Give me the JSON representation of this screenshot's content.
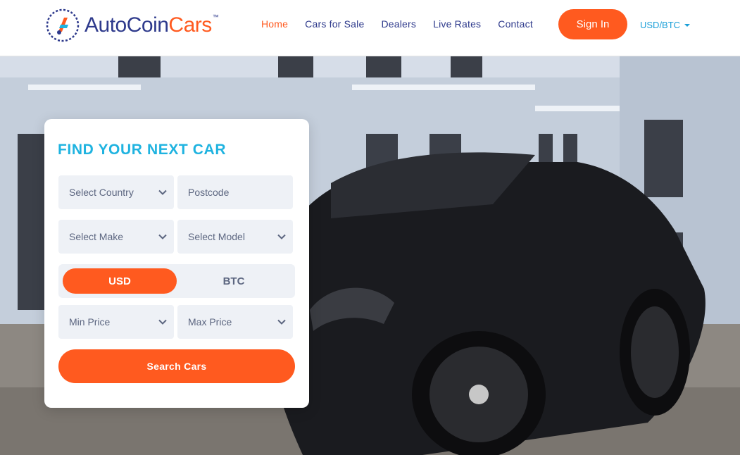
{
  "brand": {
    "name_part1": "AutoCoin",
    "name_part2": "Cars",
    "trademark": "™",
    "logo_icon": "coin-logo-icon"
  },
  "nav": {
    "items": [
      {
        "label": "Home",
        "active": true
      },
      {
        "label": "Cars for Sale",
        "active": false
      },
      {
        "label": "Dealers",
        "active": false
      },
      {
        "label": "Live Rates",
        "active": false
      },
      {
        "label": "Contact",
        "active": false
      }
    ],
    "signin_label": "Sign In",
    "currency_label": "USD/BTC"
  },
  "search": {
    "title": "FIND YOUR NEXT CAR",
    "country_placeholder": "Select Country",
    "postcode_placeholder": "Postcode",
    "make_placeholder": "Select Make",
    "model_placeholder": "Select Model",
    "currency_options": [
      "USD",
      "BTC"
    ],
    "selected_currency": "USD",
    "min_price_placeholder": "Min Price",
    "max_price_placeholder": "Max Price",
    "submit_label": "Search Cars"
  },
  "colors": {
    "accent": "#ff5a1f",
    "brand_navy": "#2e3a8c",
    "title_blue": "#1fb3e0",
    "field_bg": "#eef1f6"
  }
}
